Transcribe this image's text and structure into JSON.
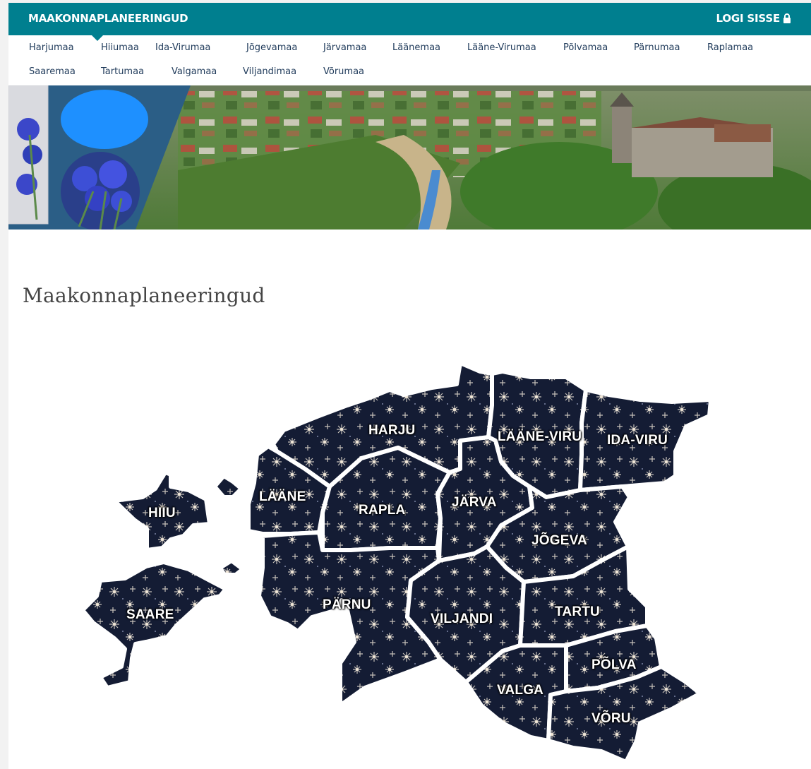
{
  "header": {
    "brand": "MAAKONNAPLANEERINGUD",
    "login": "LOGI SISSE",
    "login_icon": "lock-icon"
  },
  "nav": {
    "items": [
      {
        "label": "Harjumaa"
      },
      {
        "label": "Hiiumaa"
      },
      {
        "label": "Ida-Virumaa"
      },
      {
        "label": "Jõgevamaa"
      },
      {
        "label": "Järvamaa"
      },
      {
        "label": "Läänemaa"
      },
      {
        "label": "Lääne-Virumaa"
      },
      {
        "label": "Põlvamaa"
      },
      {
        "label": "Pärnumaa"
      },
      {
        "label": "Raplamaa"
      },
      {
        "label": "Saaremaa"
      },
      {
        "label": "Tartumaa"
      },
      {
        "label": "Valgamaa"
      },
      {
        "label": "Viljandimaa"
      },
      {
        "label": "Võrumaa"
      }
    ],
    "active": "Hiiumaa"
  },
  "banner": {
    "accent_circle": "#1e90ff",
    "flower": "cornflower-icon"
  },
  "main": {
    "title": "Maakonnaplaneeringud"
  },
  "map": {
    "counties": [
      {
        "label": "HARJU"
      },
      {
        "label": "LÄÄNE-VIRU"
      },
      {
        "label": "IDA-VIRU"
      },
      {
        "label": "LÄÄNE"
      },
      {
        "label": "HIIU"
      },
      {
        "label": "RAPLA"
      },
      {
        "label": "JÄRVA"
      },
      {
        "label": "JÕGEVA"
      },
      {
        "label": "SAARE"
      },
      {
        "label": "PÄRNU"
      },
      {
        "label": "VILJANDI"
      },
      {
        "label": "TARTU"
      },
      {
        "label": "PÕLVA"
      },
      {
        "label": "VALGA"
      },
      {
        "label": "VÕRU"
      }
    ]
  },
  "colors": {
    "header_bg": "#007f8f",
    "nav_text": "#1f3a5a",
    "title_text": "#444444"
  }
}
